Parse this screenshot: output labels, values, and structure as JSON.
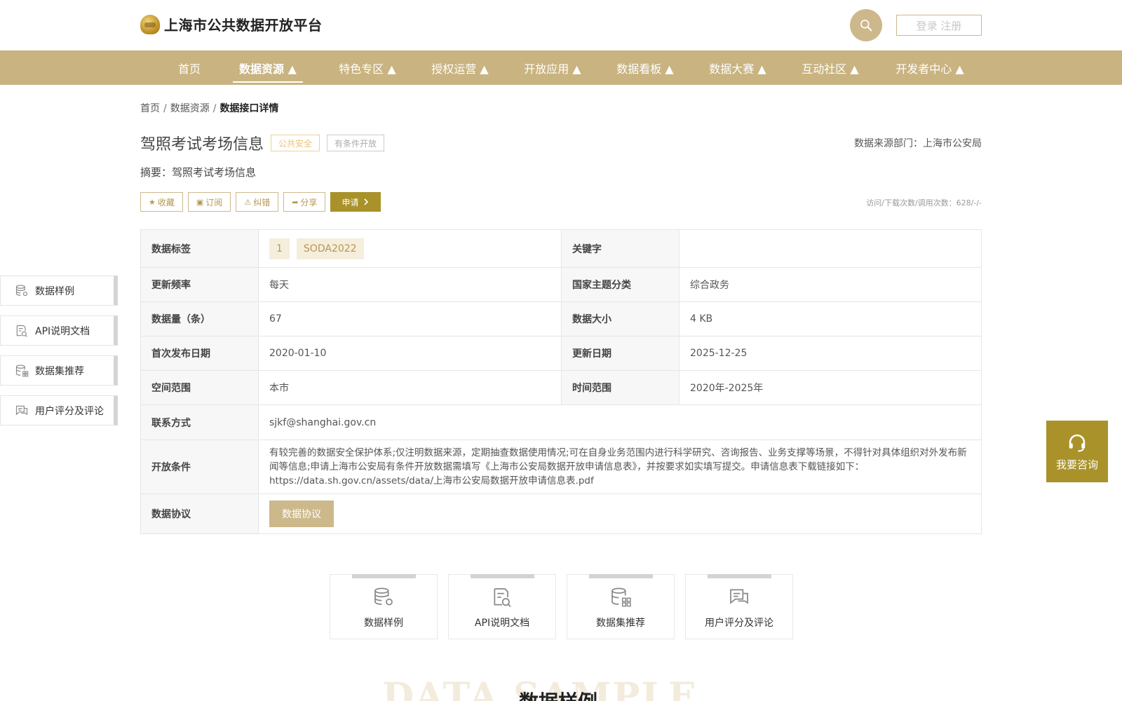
{
  "header": {
    "site_title": "上海市公共数据开放平台",
    "login_label": "登录 注册"
  },
  "nav": {
    "items": [
      {
        "label": "首页"
      },
      {
        "label": "数据资源 ▲"
      },
      {
        "label": "特色专区 ▲"
      },
      {
        "label": "授权运营 ▲"
      },
      {
        "label": "开放应用 ▲"
      },
      {
        "label": "数据看板 ▲"
      },
      {
        "label": "数据大赛 ▲"
      },
      {
        "label": "互动社区 ▲"
      },
      {
        "label": "开发者中心 ▲"
      }
    ],
    "active_index": 1
  },
  "breadcrumb": {
    "home": "首页",
    "section": "数据资源",
    "current": "数据接口详情",
    "separator": "/"
  },
  "detail": {
    "title": "驾照考试考场信息",
    "tag_category": "公共安全",
    "tag_open": "有条件开放",
    "source_dept": "数据来源部门：上海市公安局",
    "summary": "摘要：驾照考试考场信息",
    "visits": "访问/下载次数/调用次数：628/-/-"
  },
  "actions": {
    "favorite": "收藏",
    "subscribe": "订阅",
    "report": "纠错",
    "share": "分享",
    "apply": "申请"
  },
  "table": {
    "tags_label": "数据标签",
    "tags": [
      "1",
      "SODA2022"
    ],
    "keyword_label": "关键字",
    "keyword_value": "",
    "freq_label": "更新频率",
    "freq_value": "每天",
    "theme_label": "国家主题分类",
    "theme_value": "综合政务",
    "count_label": "数据量（条）",
    "count_value": "67",
    "size_label": "数据大小",
    "size_value": "4 KB",
    "first_pub_label": "首次发布日期",
    "first_pub_value": "2020-01-10",
    "update_label": "更新日期",
    "update_value": "2025-12-25",
    "space_label": "空间范围",
    "space_value": "本市",
    "time_label": "时间范围",
    "time_value": "2020年-2025年",
    "contact_label": "联系方式",
    "contact_value": "sjkf@shanghai.gov.cn",
    "condition_label": "开放条件",
    "condition_value": "有较完善的数据安全保护体系;仅注明数据来源，定期抽查数据使用情况;可在自身业务范围内进行科学研究、咨询报告、业务支撑等场景，不得针对具体组织对外发布新闻等信息;申请上海市公安局有条件开放数据需填写《上海市公安局数据开放申请信息表》，并按要求如实填写提交。申请信息表下载链接如下：https://data.sh.gov.cn/assets/data/上海市公安局数据开放申请信息表.pdf",
    "protocol_label": "数据协议",
    "protocol_button": "数据协议"
  },
  "side_nav": {
    "items": [
      {
        "label": "数据样例",
        "icon": "database-gear-icon"
      },
      {
        "label": "API说明文档",
        "icon": "doc-search-icon"
      },
      {
        "label": "数据集推荐",
        "icon": "database-grid-icon"
      },
      {
        "label": "用户评分及评论",
        "icon": "comment-icon"
      }
    ]
  },
  "consult": {
    "label": "我要咨询",
    "icon": "headset-icon"
  },
  "cards": [
    {
      "label": "数据样例",
      "icon": "database-gear-icon"
    },
    {
      "label": "API说明文档",
      "icon": "doc-search-icon"
    },
    {
      "label": "数据集推荐",
      "icon": "database-grid-icon"
    },
    {
      "label": "用户评分及评论",
      "icon": "comment-icon"
    }
  ],
  "section": {
    "watermark": "DATA SAMPLE",
    "title": "数据样例"
  },
  "colors": {
    "brand_gold": "#c9b380",
    "apply_button": "#a9922a",
    "tag_gold": "#e8c378"
  }
}
